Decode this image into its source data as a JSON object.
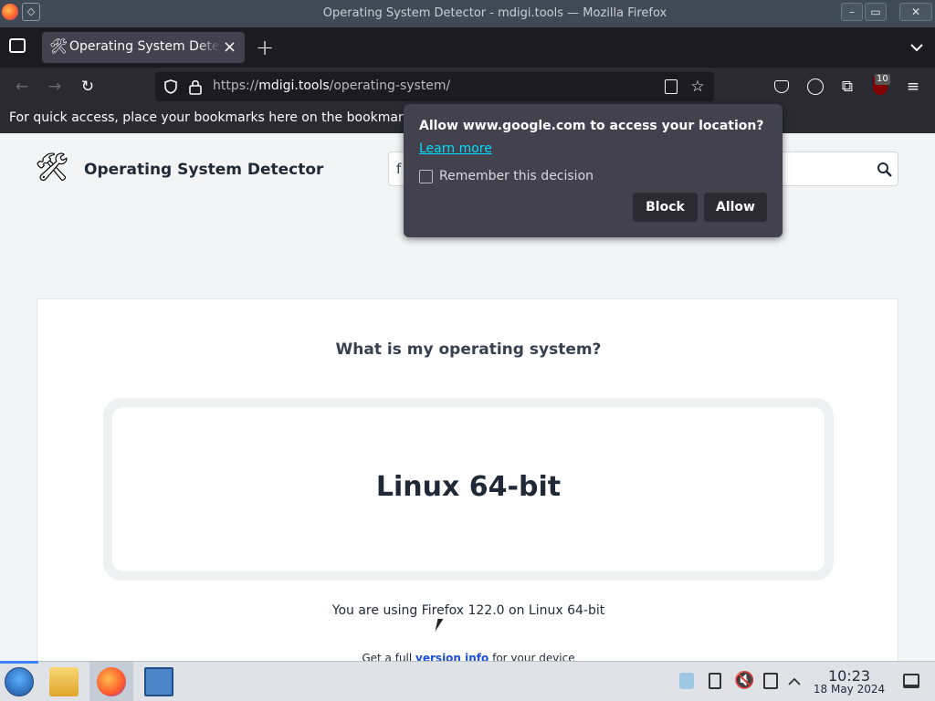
{
  "window": {
    "title": "Operating System Detector - mdigi.tools — Mozilla Firefox",
    "controls": {
      "minimize": "–",
      "maximize": "▭",
      "close": "✕"
    }
  },
  "browser": {
    "tab": {
      "label": "Operating System Detec",
      "close": "×"
    },
    "new_tab": "+",
    "url": {
      "prefix": "https://",
      "domain": "mdigi.tools",
      "path": "/operating-system/"
    },
    "extension_badge": "10",
    "bookmarks_text": "For quick access, place your bookmarks here on the bookmarks t"
  },
  "permission_popup": {
    "title": "Allow www.google.com to access your location?",
    "learn_more": "Learn more",
    "remember": "Remember this decision",
    "block_label": "Block",
    "allow_label": "Allow"
  },
  "page": {
    "site_name": "Operating System Detector",
    "search_partial": "f",
    "heading": "What is my operating system?",
    "os_result": "Linux 64-bit",
    "using_text": "You are using Firefox 122.0 on Linux 64-bit",
    "full_info_prefix": "Get a full ",
    "full_info_link": "version info",
    "full_info_suffix": " for your device"
  },
  "taskbar": {
    "time": "10:23",
    "date": "18 May 2024"
  },
  "colors": {
    "accent_link": "#00ddff",
    "page_link": "#1d4ed8",
    "popup_bg": "#42414d"
  }
}
